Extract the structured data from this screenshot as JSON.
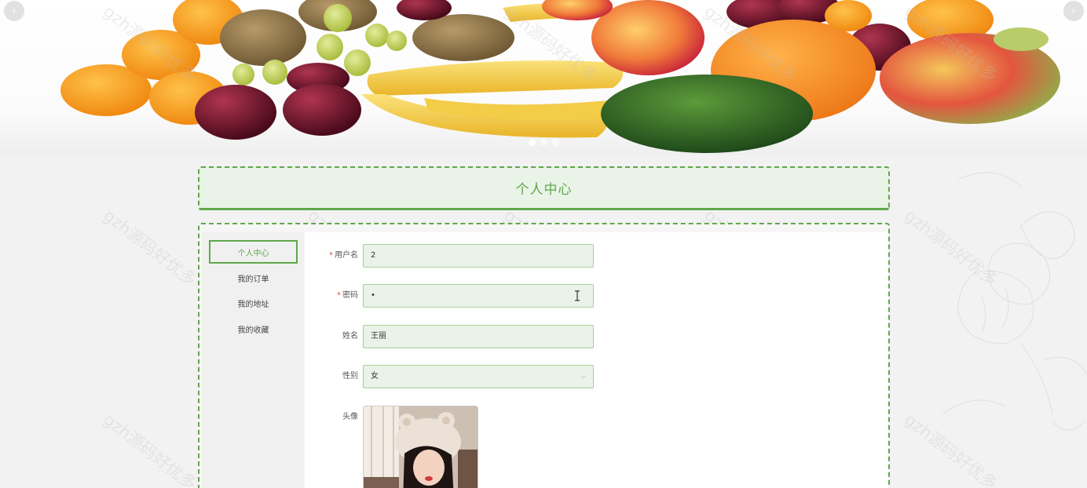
{
  "carousel": {
    "prev_icon": "chevron-left-icon",
    "next_icon": "chevron-right-icon",
    "slide_count": 3,
    "active_index": 0
  },
  "watermark": "gzh源码好优多",
  "title": "个人中心",
  "sidebar": {
    "items": [
      {
        "label": "个人中心",
        "active": true
      },
      {
        "label": "我的订单",
        "active": false
      },
      {
        "label": "我的地址",
        "active": false
      },
      {
        "label": "我的收藏",
        "active": false
      }
    ]
  },
  "form": {
    "username": {
      "label": "用户名",
      "required_mark": "*",
      "value": "2"
    },
    "password": {
      "label": "密码",
      "required_mark": "*",
      "value": "•"
    },
    "name": {
      "label": "姓名",
      "value": "王丽"
    },
    "gender": {
      "label": "性别",
      "value": "女"
    },
    "avatar": {
      "label": "头像"
    }
  },
  "colors": {
    "accent": "#5fa84a",
    "input_bg": "#e9f3e7",
    "required": "#e04b4b"
  }
}
